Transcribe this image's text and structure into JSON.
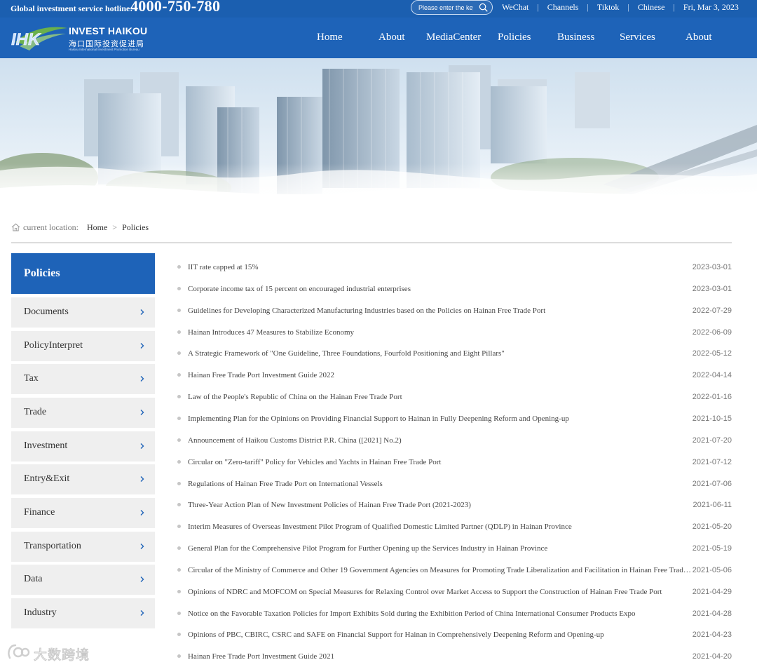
{
  "topbar": {
    "hotline_label": "Global investment service hotline:",
    "hotline_number": "4000-750-780",
    "search_placeholder": "Please enter the key",
    "links": [
      "WeChat",
      "Channels",
      "Tiktok",
      "Chinese"
    ],
    "date": "Fri, Mar 3, 2023"
  },
  "logo": {
    "mark": "IHK",
    "title": "INVEST HAIKOU",
    "cn": "海口国际投资促进局",
    "en": "Haikou International Investment Promotion Bureau"
  },
  "nav": [
    "Home",
    "About",
    "MediaCenter",
    "Policies",
    "Business",
    "Services",
    "About"
  ],
  "breadcrumb": {
    "label": "current location:",
    "home": "Home",
    "separator": ">",
    "current": "Policies"
  },
  "sidebar": {
    "heading": "Policies",
    "items": [
      {
        "label": "Documents"
      },
      {
        "label": "PolicyInterpret"
      },
      {
        "label": "Tax"
      },
      {
        "label": "Trade"
      },
      {
        "label": "Investment"
      },
      {
        "label": "Entry&Exit"
      },
      {
        "label": "Finance"
      },
      {
        "label": "Transportation"
      },
      {
        "label": "Data"
      },
      {
        "label": "Industry"
      }
    ]
  },
  "policies": [
    {
      "title": "IIT rate capped at 15%",
      "date": "2023-03-01"
    },
    {
      "title": "Corporate income tax of 15 percent on encouraged industrial enterprises",
      "date": "2023-03-01"
    },
    {
      "title": "Guidelines for Developing Characterized Manufacturing Industries based on the Policies on Hainan Free Trade Port",
      "date": "2022-07-29"
    },
    {
      "title": "Hainan Introduces 47 Measures to Stabilize Economy",
      "date": "2022-06-09"
    },
    {
      "title": "A Strategic Framework of \"One Guideline, Three Foundations, Fourfold Positioning and Eight Pillars\"",
      "date": "2022-05-12"
    },
    {
      "title": "Hainan Free Trade Port Investment Guide 2022",
      "date": "2022-04-14"
    },
    {
      "title": "Law of the People's Republic of China on the Hainan Free Trade Port",
      "date": "2022-01-16"
    },
    {
      "title": "Implementing Plan for the Opinions on Providing Financial Support to Hainan in Fully Deepening Reform and Opening-up",
      "date": "2021-10-15"
    },
    {
      "title": "Announcement of Haikou Customs District P.R. China ([2021] No.2)",
      "date": "2021-07-20"
    },
    {
      "title": "Circular on \"Zero-tariff\" Policy for Vehicles and Yachts in Hainan Free Trade Port",
      "date": "2021-07-12"
    },
    {
      "title": "Regulations of Hainan Free Trade Port on International Vessels",
      "date": "2021-07-06"
    },
    {
      "title": "Three-Year Action Plan of New Investment Policies of Hainan Free Trade Port (2021-2023)",
      "date": "2021-06-11"
    },
    {
      "title": "Interim Measures of Overseas Investment Pilot Program of Qualified Domestic Limited Partner (QDLP) in Hainan Province",
      "date": "2021-05-20"
    },
    {
      "title": "General Plan for the Comprehensive Pilot Program for Further Opening up the Services Industry in Hainan Province",
      "date": "2021-05-19"
    },
    {
      "title": "Circular of the Ministry of Commerce and Other 19 Government Agencies on Measures for Promoting Trade Liberalization and Facilitation in Hainan Free Trade Port",
      "date": "2021-05-06"
    },
    {
      "title": "Opinions of NDRC and MOFCOM on Special Measures for Relaxing Control over Market Access to Support the Construction of Hainan Free Trade Port",
      "date": "2021-04-29"
    },
    {
      "title": "Notice on the Favorable Taxation Policies for Import Exhibits Sold during the Exhibition Period of China International Consumer Products Expo",
      "date": "2021-04-28"
    },
    {
      "title": "Opinions of PBC, CBIRC, CSRC and SAFE on Financial Support for Hainan in Comprehensively Deepening Reform and Opening-up",
      "date": "2021-04-23"
    },
    {
      "title": "Hainan Free Trade Port Investment Guide 2021",
      "date": "2021-04-20"
    }
  ],
  "watermark": "大数跨境",
  "colors": {
    "brand_blue": "#1e63b8",
    "sidebar_bg": "#efefef",
    "logo_green": "#6ab04c"
  }
}
